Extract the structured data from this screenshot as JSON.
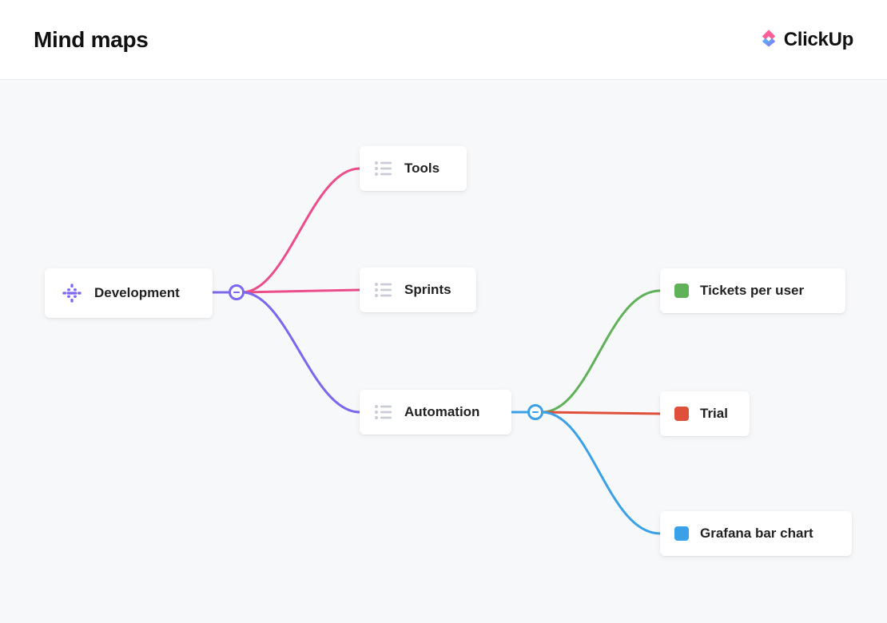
{
  "header": {
    "title": "Mind maps",
    "brand": "ClickUp"
  },
  "nodes": {
    "root": {
      "label": "Development"
    },
    "tools": {
      "label": "Tools"
    },
    "sprints": {
      "label": "Sprints"
    },
    "automation": {
      "label": "Automation"
    },
    "tickets_per_user": {
      "label": "Tickets per user"
    },
    "trial": {
      "label": "Trial"
    },
    "grafana_bar_chart": {
      "label": "Grafana bar chart"
    }
  },
  "colors": {
    "root_branch_top": "#ec4d8b",
    "root_branch_mid": "#ec4d8b",
    "root_branch_bot": "#7b68ee",
    "auto_branch_top": "#60b158",
    "auto_branch_mid": "#e04f39",
    "auto_branch_bot": "#3aa0e8",
    "root_handle": "#7b68ee",
    "auto_handle": "#3aa0e8",
    "globe": "#7b68ee",
    "sq_green": "#60b158",
    "sq_red": "#e04f39",
    "sq_blue": "#3aa0e8"
  }
}
